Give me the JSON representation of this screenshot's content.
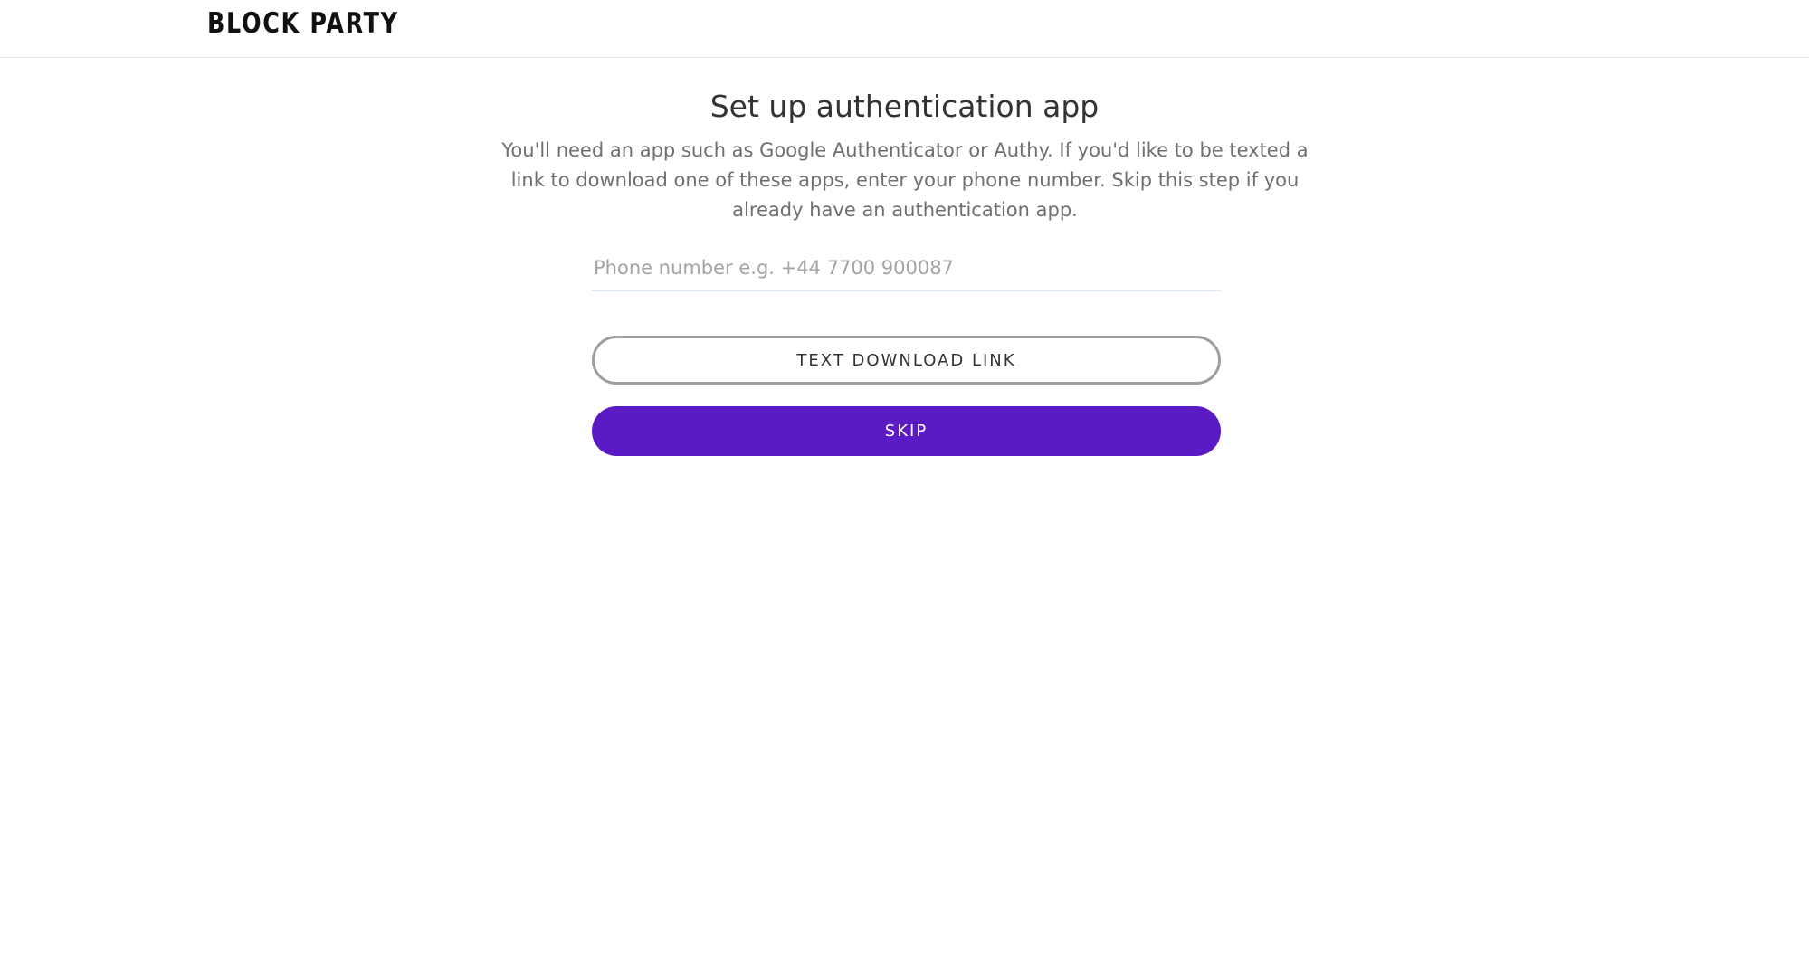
{
  "header": {
    "logo_text": "BLOCK PARTY"
  },
  "main": {
    "title": "Set up authentication app",
    "description": "You'll need an app such as Google Authenticator or Authy. If you'd like to be texted a link to download one of these apps, enter your phone number. Skip this step if you already have an authentication app.",
    "phone": {
      "value": "",
      "placeholder": "Phone number e.g. +44 7700 900087"
    },
    "text_download_label": "TEXT DOWNLOAD LINK",
    "skip_label": "SKIP"
  },
  "colors": {
    "primary": "#5b1bc4",
    "outline_border": "#9e9e9e",
    "input_underline": "#dde3ec"
  }
}
